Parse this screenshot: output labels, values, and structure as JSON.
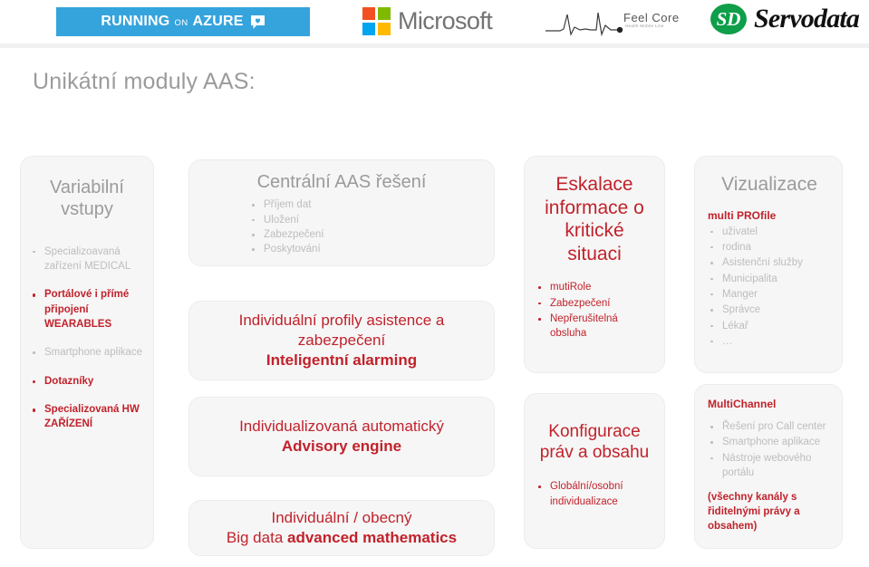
{
  "header": {
    "azure_badge": {
      "word1": "RUNNING",
      "word2": "ON",
      "word3": "AZURE",
      "icon": "heart-bubble-icon",
      "color": "#35a4dd"
    },
    "microsoft": {
      "wordmark": "Microsoft",
      "tile_colors": [
        "#f25022",
        "#7fba00",
        "#00a4ef",
        "#ffb900"
      ]
    },
    "feelcore": {
      "wordmark": "Feel Core",
      "tagline": "Health Mobile Line",
      "icon": "ecg-waveform-icon"
    },
    "servodata": {
      "mark": "SD",
      "wordmark": "Servodata",
      "color": "#0f9e49"
    }
  },
  "page_title": "Unikátní moduly AAS:",
  "accent_color": "#c1222b",
  "muted_color": "#bdbdbd",
  "cards": {
    "inputs": {
      "title": "Variabilní\nvstupy",
      "title_line1": "Variabilní",
      "title_line2": "vstupy",
      "bullets": [
        {
          "text": "Specializoavaná zařízení MEDICAL",
          "highlight": false
        },
        {
          "text": "Portálové i přímé připojení WEARABLES",
          "highlight": true
        },
        {
          "text": "Smartphone aplikace",
          "highlight": false
        },
        {
          "text": "Dotazníky",
          "highlight": true
        },
        {
          "text": "Specializovaná HW ZAŘÍZENÍ",
          "highlight": true
        }
      ]
    },
    "central": {
      "title": "Centrální AAS řešení",
      "bullets": [
        {
          "text": "Příjem dat",
          "highlight": false
        },
        {
          "text": "Uložení",
          "highlight": false
        },
        {
          "text": "Zabezpečení",
          "highlight": false
        },
        {
          "text": "Poskytování",
          "highlight": false
        }
      ]
    },
    "profiles": {
      "regular_line1": "Individuální profily asistence a",
      "regular_line2": "zabezpečení",
      "bold": "Inteligentní alarming"
    },
    "advisory": {
      "regular": "Individualizovaná automatický",
      "bold": "Advisory engine"
    },
    "bigdata": {
      "regular": "Individuální / obecný",
      "bold_prefix": "Big data ",
      "bold": "advanced mathematics"
    },
    "escalation": {
      "title": "Eskalace informace o kritické situaci",
      "bullets": [
        {
          "text": "mutiRole",
          "highlight": true
        },
        {
          "text": "Zabezpečení",
          "highlight": true
        },
        {
          "text": "Nepřerušitelná obsluha",
          "highlight": true
        }
      ]
    },
    "config": {
      "title": "Konfigurace práv a obsahu",
      "bullets": [
        {
          "text": "Globální/osobní individualizace",
          "highlight": true
        }
      ]
    },
    "visualization": {
      "title": "Vizualizace",
      "subhead": "multi PROfile",
      "bullets": [
        {
          "text": "uživatel",
          "highlight": false
        },
        {
          "text": "rodina",
          "highlight": false
        },
        {
          "text": "Asistenční služby",
          "highlight": false
        },
        {
          "text": "Municipalita",
          "highlight": false
        },
        {
          "text": "Manger",
          "highlight": false
        },
        {
          "text": "Správce",
          "highlight": false
        },
        {
          "text": "Lékař",
          "highlight": false
        },
        {
          "text": "…",
          "highlight": false
        }
      ]
    },
    "multichannel": {
      "subhead": "MultiChannel",
      "bullets": [
        {
          "text": "Řešení pro Call center",
          "highlight": false
        },
        {
          "text": "Smartphone aplikace",
          "highlight": false
        },
        {
          "text": "Nástroje webového portálu",
          "highlight": false
        }
      ],
      "note": "(všechny kanály s řiditelnými právy a obsahem)"
    }
  }
}
